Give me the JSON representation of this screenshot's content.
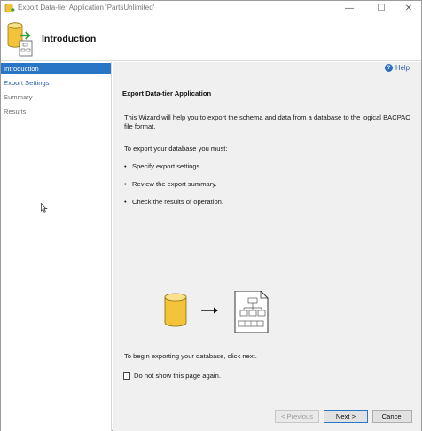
{
  "window": {
    "title": "Export Data-tier Application 'PartsUnlimited'",
    "controls": {
      "minimize": "—",
      "maximize": "☐",
      "close": "✕"
    }
  },
  "header": {
    "title": "Introduction"
  },
  "sidebar": {
    "items": [
      {
        "label": "Introduction",
        "state": "active"
      },
      {
        "label": "Export Settings",
        "state": "link"
      },
      {
        "label": "Summary",
        "state": "inactive"
      },
      {
        "label": "Results",
        "state": "inactive"
      }
    ]
  },
  "main": {
    "help_label": "Help",
    "section_title": "Export Data-tier Application",
    "description": "This Wizard will help you to export the schema and data from a database to the logical BACPAC file format.",
    "must_intro": "To export your database you must:",
    "steps": [
      "Specify export settings.",
      "Review the export summary.",
      "Check the results of operation."
    ],
    "begin_text": "To begin exporting your database, click next.",
    "checkbox_label": "Do not show this page again.",
    "checkbox_checked": false
  },
  "buttons": {
    "previous": "< Previous",
    "next": "Next >",
    "cancel": "Cancel"
  },
  "colors": {
    "accent": "#2a76c6",
    "pane_background": "#f0f0f0",
    "database_yellow": "#f3c43a"
  }
}
